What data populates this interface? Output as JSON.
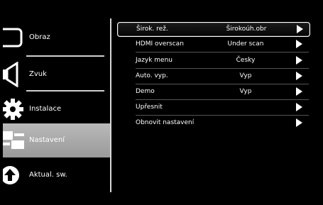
{
  "left_menu": {
    "items": [
      {
        "label": "Obraz",
        "icon": "picture-icon"
      },
      {
        "label": "Zvuk",
        "icon": "speaker-icon"
      },
      {
        "label": "Instalace",
        "icon": "gear-icon"
      },
      {
        "label": "Nastavení",
        "icon": "settings-sliders-icon",
        "selected": true
      },
      {
        "label": "Aktual. sw.",
        "icon": "update-icon"
      }
    ]
  },
  "settings": {
    "rows": [
      {
        "name": "Širok. rež.",
        "value": "Širokoúh.obr",
        "focused": true
      },
      {
        "name": "HDMI overscan",
        "value": "Under scan"
      },
      {
        "name": "Jazyk menu",
        "value": "Česky"
      },
      {
        "name": "Auto. vyp.",
        "value": "Vyp"
      },
      {
        "name": "Demo",
        "value": "Vyp"
      },
      {
        "name": "Upřesnit",
        "value": ""
      },
      {
        "name": "Obnovit nastavení",
        "value": ""
      }
    ]
  }
}
